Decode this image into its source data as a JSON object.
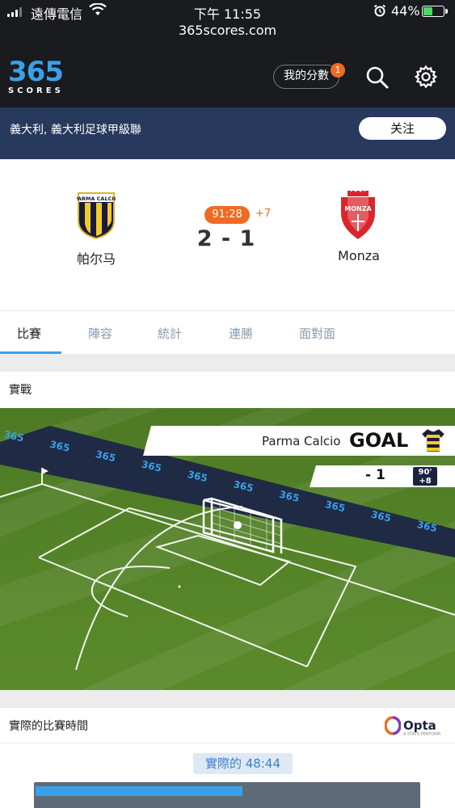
{
  "status_bar": {
    "carrier": "遠傳電信",
    "time": "下午 11:55",
    "battery_percent": "44%",
    "battery_level": 0.44
  },
  "browser": {
    "url": "365scores.com"
  },
  "app_header": {
    "logo_number": "365",
    "logo_word": "SCORES",
    "my_score_label": "我的分數",
    "notification_count": "1"
  },
  "league": {
    "name": "義大利, 義大利足球甲級聯",
    "follow_label": "关注",
    "bar_color": "#27395c"
  },
  "match": {
    "home_team": "帕尔马",
    "away_team": "Monza",
    "home_crest_text": "PARMA CALCIO",
    "away_crest_text": "MONZA",
    "minute": "91:28",
    "added_time": "+7",
    "score": "2 - 1",
    "accent_color": "#f06a22"
  },
  "tabs": [
    {
      "label": "比賽",
      "active": true
    },
    {
      "label": "陣容",
      "active": false
    },
    {
      "label": "統計",
      "active": false
    },
    {
      "label": "連勝",
      "active": false
    },
    {
      "label": "面對面",
      "active": false
    }
  ],
  "live": {
    "section_title": "實戰",
    "event_team": "Parma Calcio",
    "event_type": "GOAL",
    "event_score": "- 1",
    "event_minute": "90'",
    "event_added": "+8",
    "board_text": "365"
  },
  "play_time": {
    "section_title": "實際的比賽時間",
    "provider": "Opta",
    "provider_sub": "A STATS PERFORM",
    "actual_label": "實際的 48:44",
    "bar_fraction": 0.54
  }
}
